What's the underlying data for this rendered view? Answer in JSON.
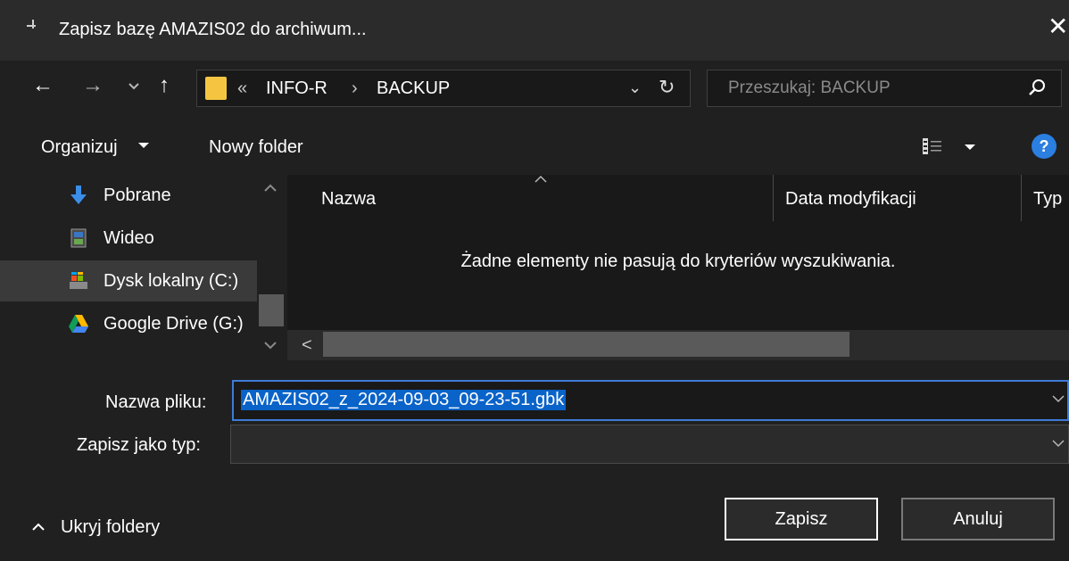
{
  "window": {
    "title": "Zapisz bazę AMAZIS02 do archiwum...",
    "close_glyph": "✕",
    "icon": "app-icon"
  },
  "address": {
    "back_glyph": "←",
    "forward_glyph": "→",
    "up_glyph": "↑",
    "overflow": "«",
    "crumbs": [
      "INFO-R",
      "BACKUP"
    ],
    "separator": "›",
    "dropdown_glyph": "⌄",
    "refresh_glyph": "↻",
    "search_placeholder": "Przeszukaj: BACKUP"
  },
  "toolbar": {
    "organize": "Organizuj",
    "new_folder": "Nowy folder",
    "help": "?"
  },
  "nav_pane": {
    "items": [
      {
        "label": "Pobrane",
        "icon": "download-icon"
      },
      {
        "label": "Wideo",
        "icon": "video-icon"
      },
      {
        "label": "Dysk lokalny (C:)",
        "icon": "local-disk-icon"
      },
      {
        "label": "Google Drive (G:)",
        "icon": "google-drive-icon"
      }
    ],
    "selected_index": 2
  },
  "file_list": {
    "columns": [
      "Nazwa",
      "Data modyfikacji",
      "Typ"
    ],
    "empty_message": "Żadne elementy nie pasują do kryteriów wyszukiwania.",
    "scroll_left_glyph": "<"
  },
  "form": {
    "file_name_label": "Nazwa pliku:",
    "file_name_value": "AMAZIS02_z_2024-09-03_09-23-51.gbk",
    "save_type_label": "Zapisz jako typ:",
    "save_type_value": ""
  },
  "footer": {
    "hide_folders": "Ukryj foldery",
    "save_button": "Zapisz",
    "cancel_button": "Anuluj"
  },
  "colors": {
    "background": "#202020",
    "selection": "#0a63c8",
    "focus_border": "#3f7ad8",
    "folder": "#f5c542"
  }
}
